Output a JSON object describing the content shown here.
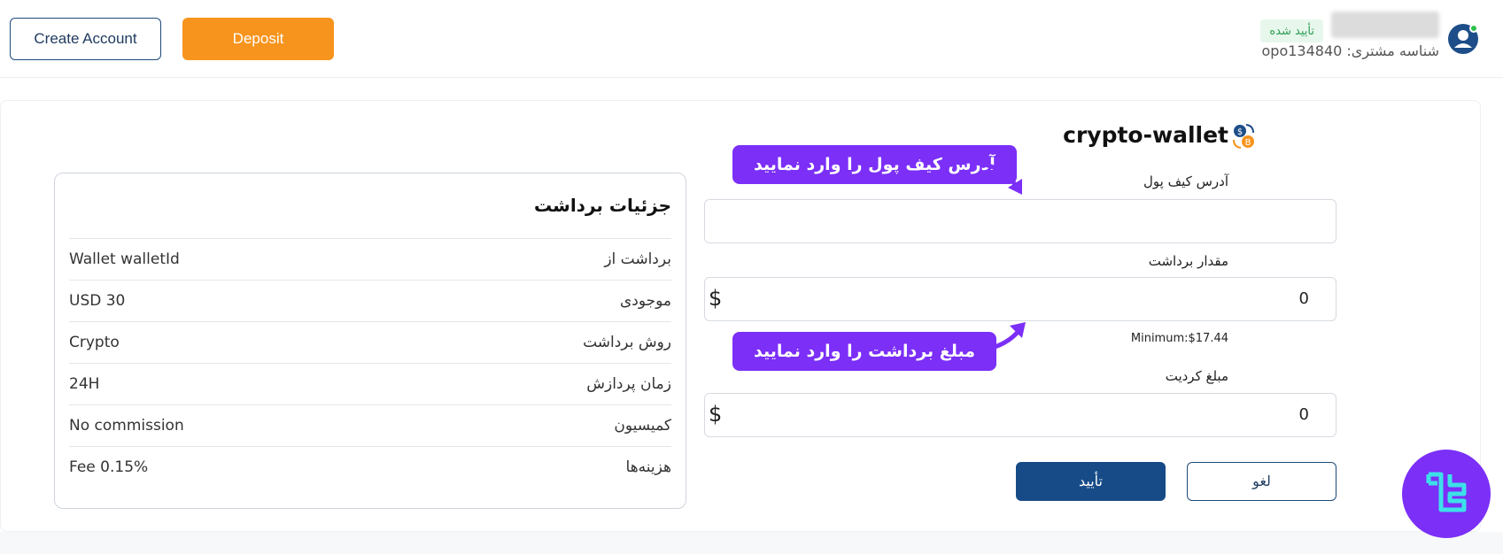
{
  "header": {
    "create_account": "Create Account",
    "deposit": "Deposit",
    "verified_badge": "تأیید شده",
    "customer_id": "شناسه مشتری: opo134840"
  },
  "details": {
    "title": "جزئیات برداشت",
    "rows": [
      {
        "label": "برداشت از",
        "value": "Wallet walletId"
      },
      {
        "label": "موجودی",
        "value": "USD 30"
      },
      {
        "label": "روش برداشت",
        "value": "Crypto"
      },
      {
        "label": "زمان پردازش",
        "value": "24H"
      },
      {
        "label": "کمیسیون",
        "value": "No commission"
      },
      {
        "label": "هزینه‌ها",
        "value": "Fee 0.15%"
      }
    ]
  },
  "form": {
    "title": "crypto-wallet",
    "wallet_address_label": "آدرس کیف پول",
    "wallet_address_value": "",
    "amount_label": "مقدار برداشت",
    "amount_value": "0",
    "amount_currency": "$",
    "minimum": "Minimum:$17.44",
    "credit_label": "مبلغ کردیت",
    "credit_value": "0",
    "credit_currency": "$",
    "cancel": "لغو",
    "confirm": "تأیید"
  },
  "annotations": {
    "wallet_callout": "آدرس کیف پول را وارد نمایید",
    "amount_callout": "مبلغ برداشت را وارد نمایید"
  },
  "colors": {
    "deposit": "#f7941d",
    "primary": "#164b87",
    "callout": "#7b2ff7",
    "verified": "#2d9d52"
  },
  "icons": [
    "user-avatar-icon",
    "crypto-wallet-icon",
    "callout-arrow-icon",
    "brand-logo-icon"
  ]
}
